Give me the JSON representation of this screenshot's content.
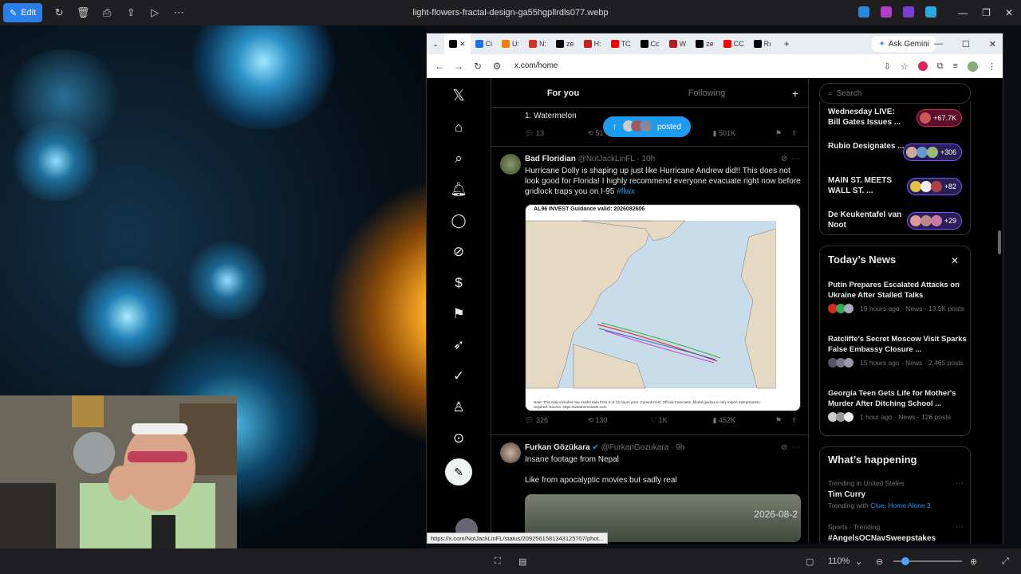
{
  "viewer": {
    "edit_label": "Edit",
    "filename": "light-flowers-fractal-design-ga55hgpllrdls077.webp",
    "zoom": "110%"
  },
  "browser": {
    "tabs": [
      {
        "favicon": "x-icon",
        "label": "",
        "color": "#000000"
      },
      {
        "favicon": "upi-icon",
        "label": "Ci",
        "color": "#1a73e8"
      },
      {
        "favicon": "blog-icon",
        "label": "U:",
        "color": "#f57c00"
      },
      {
        "favicon": "doc-icon",
        "label": "N:",
        "color": "#d93025"
      },
      {
        "favicon": "x-icon",
        "label": "ze",
        "color": "#000000"
      },
      {
        "favicon": "home-icon",
        "label": "H:",
        "color": "#c5221f"
      },
      {
        "favicon": "youtube-icon",
        "label": "TC",
        "color": "#ff0000"
      },
      {
        "favicon": "x-icon",
        "label": "Cc",
        "color": "#000000"
      },
      {
        "favicon": "news-icon",
        "label": "W",
        "color": "#b71c1c"
      },
      {
        "favicon": "x-icon",
        "label": "ze",
        "color": "#000000"
      },
      {
        "favicon": "youtube-icon",
        "label": "CC",
        "color": "#ff0000"
      },
      {
        "favicon": "x-icon",
        "label": "Rı",
        "color": "#000000"
      }
    ],
    "gemini_label": "Ask Gemini",
    "url": "x.com/home",
    "status_url": "https://x.com/NotJackLinFL/status/2092561581343125707/phot..."
  },
  "feed": {
    "tabs": [
      "For you",
      "Following"
    ],
    "posted_label": "posted",
    "prev_text": "1. Watermelon",
    "prev_actions": {
      "replies": "13",
      "reposts": "51",
      "likes": "",
      "views": "501K"
    },
    "tweets": [
      {
        "name": "Bad Floridian",
        "handle": "@NotJackLinFL",
        "time": "· 10h",
        "text": "Hurricane Dolly is shaping up just like Hurricane Andrew did!! This does not look good for Florida! I highly recommend everyone evacuate right now before gridlock traps you on I-95 ",
        "hashtag": "#flwx",
        "map_title": "AL96 INVEST Guidance valid: 2026082606",
        "map_note": "Note: This map includes raw model data from 6 or 12 hours prior. Consult NHC Official Forecasts. Modal guidance only expert interpretation required. Source: https://weathermodels.com",
        "replies": "326",
        "reposts": "130",
        "likes": "1K",
        "views": "452K"
      },
      {
        "name": "Furkan Gözükara",
        "handle": "@FurkanGozukara",
        "time": "· 9h",
        "text1": "Insane footage from Nepal",
        "text2": "Like from apocalyptic movies but sadly real",
        "video_ts": "2026-08-2"
      }
    ]
  },
  "sidebar": {
    "search_placeholder": "Search",
    "spaces": [
      {
        "title": "Wednesday LIVE: Bill Gates Issues ...",
        "count": "+67.7K"
      },
      {
        "title": "Rubio Designates ...",
        "count": "+306"
      },
      {
        "title": "MAIN ST. MEETS WALL ST. ...",
        "count": "+82"
      },
      {
        "title": "De Keukentafel van Noot",
        "count": "+29"
      }
    ],
    "news_header": "Today’s News",
    "news": [
      {
        "title": "Putin Prepares Escalated Attacks on Ukraine After Stalled Talks",
        "meta": "19 hours ago · News · 13.5K posts"
      },
      {
        "title": "Ratcliffe's Secret Moscow Visit Sparks False Embassy Closure ...",
        "meta": "15 hours ago · News · 2,465 posts"
      },
      {
        "title": "Georgia Teen Gets Life for Mother's Murder After Ditching School ...",
        "meta": "1 hour ago · News · 126 posts"
      }
    ],
    "happening_header": "What’s happening",
    "trends": [
      {
        "context": "Trending in United States",
        "name": "Tim Curry",
        "sub_prefix": "Trending with ",
        "sub_links": "Clue, Home Alone 2"
      },
      {
        "context": "Sports · Trending",
        "name": "#AngelsOCNavSweepstakes"
      }
    ]
  }
}
